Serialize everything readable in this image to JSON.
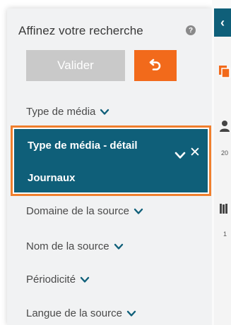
{
  "panel": {
    "heading": "Affinez votre recherche",
    "help_icon_glyph": "?",
    "validate_label": "Valider",
    "reset_icon": "undo-icon",
    "colors": {
      "accent_orange": "#f26a1b",
      "selected_bg": "#0f5f79",
      "selected_border": "#f07f2d",
      "validate_disabled": "#c9c9c9"
    }
  },
  "filters": {
    "media_type": "Type de média",
    "selected": {
      "title": "Type de média - détail",
      "value": "Journaux"
    },
    "source_domain": "Domaine de la source",
    "source_name": "Nom de la source",
    "periodicity": "Périodicité",
    "source_language": "Langue de la source"
  },
  "right_panel": {
    "collapse_glyph": "‹",
    "num_1": "20",
    "num_2": "1"
  }
}
